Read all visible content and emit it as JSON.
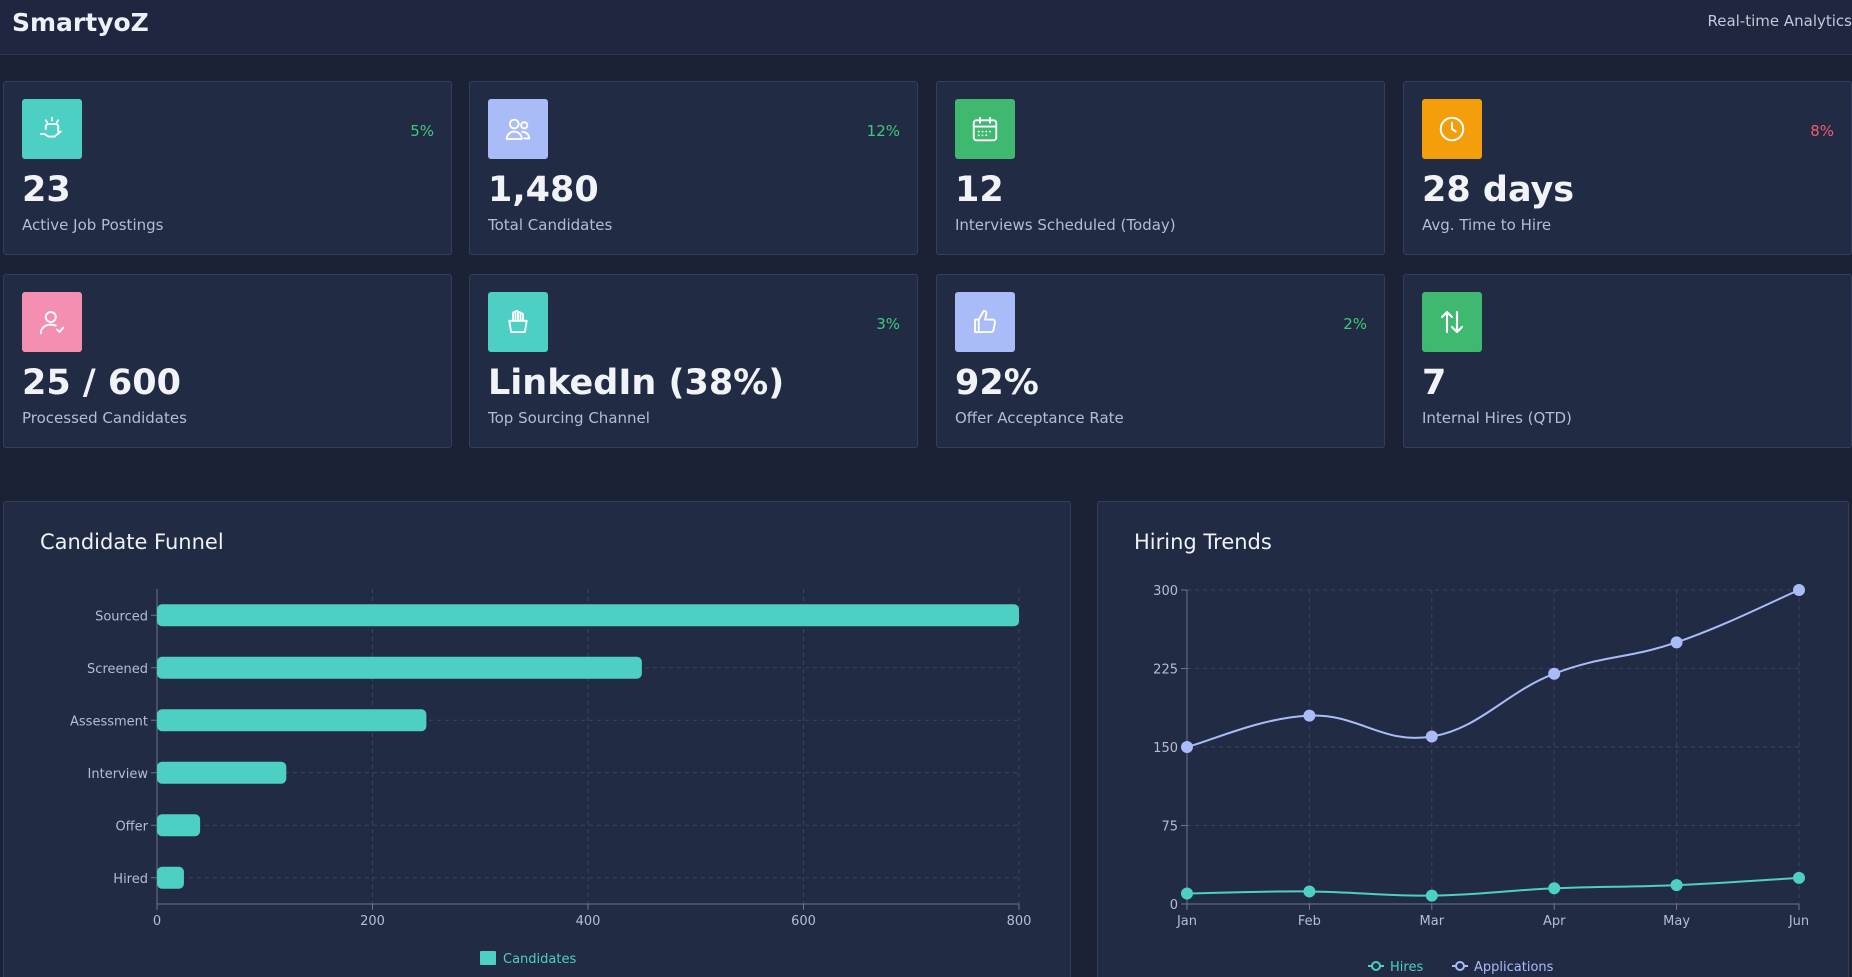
{
  "header": {
    "brand": "SmartyoZ",
    "status": "Real-time Analytics"
  },
  "colors": {
    "up": "#3fca78",
    "down": "#f25c6a",
    "teal": "#4ecfc3",
    "lavender": "#a9bcf7"
  },
  "stats": [
    {
      "value": "23",
      "label": "Active Job Postings",
      "change": "5%",
      "trend": "up",
      "icon": "hiring-hands-icon",
      "icon_color": "#4ecfc3"
    },
    {
      "value": "1,480",
      "label": "Total Candidates",
      "change": "12%",
      "trend": "up",
      "icon": "users-icon",
      "icon_color": "#a9bcf7"
    },
    {
      "value": "12",
      "label": "Interviews Scheduled (Today)",
      "change": "",
      "trend": "",
      "icon": "calendar-icon",
      "icon_color": "#3fb870"
    },
    {
      "value": "28 days",
      "label": "Avg. Time to Hire",
      "change": "8%",
      "trend": "down",
      "icon": "clock-icon",
      "icon_color": "#f59e0b"
    },
    {
      "value": "25 / 600",
      "label": "Processed Candidates",
      "change": "",
      "trend": "",
      "icon": "user-check-icon",
      "icon_color": "#f48fb1"
    },
    {
      "value": "LinkedIn (38%)",
      "label": "Top Sourcing Channel",
      "change": "3%",
      "trend": "up",
      "icon": "basket-icon",
      "icon_color": "#4ecfc3"
    },
    {
      "value": "92%",
      "label": "Offer Acceptance Rate",
      "change": "2%",
      "trend": "up",
      "icon": "thumbs-up-icon",
      "icon_color": "#a9bcf7"
    },
    {
      "value": "7",
      "label": "Internal Hires (QTD)",
      "change": "",
      "trend": "",
      "icon": "transfer-arrows-icon",
      "icon_color": "#3fb870"
    }
  ],
  "funnel": {
    "title": "Candidate Funnel",
    "chart_data": {
      "type": "bar",
      "orientation": "horizontal",
      "categories": [
        "Sourced",
        "Screened",
        "Assessment",
        "Interview",
        "Offer",
        "Hired"
      ],
      "series": [
        {
          "name": "Candidates",
          "values": [
            800,
            450,
            250,
            120,
            40,
            25
          ]
        }
      ],
      "xlim": [
        0,
        800
      ],
      "xticks": [
        0,
        200,
        400,
        600,
        800
      ],
      "grid": true,
      "legend": "bottom"
    }
  },
  "trends": {
    "title": "Hiring Trends",
    "chart_data": {
      "type": "line",
      "x": [
        "Jan",
        "Feb",
        "Mar",
        "Apr",
        "May",
        "Jun"
      ],
      "series": [
        {
          "name": "Hires",
          "values": [
            10,
            12,
            8,
            15,
            18,
            25
          ]
        },
        {
          "name": "Applications",
          "values": [
            150,
            180,
            160,
            220,
            250,
            300
          ]
        }
      ],
      "ylim": [
        0,
        300
      ],
      "yticks": [
        0,
        75,
        150,
        225,
        300
      ],
      "grid": true,
      "legend": "bottom"
    }
  }
}
